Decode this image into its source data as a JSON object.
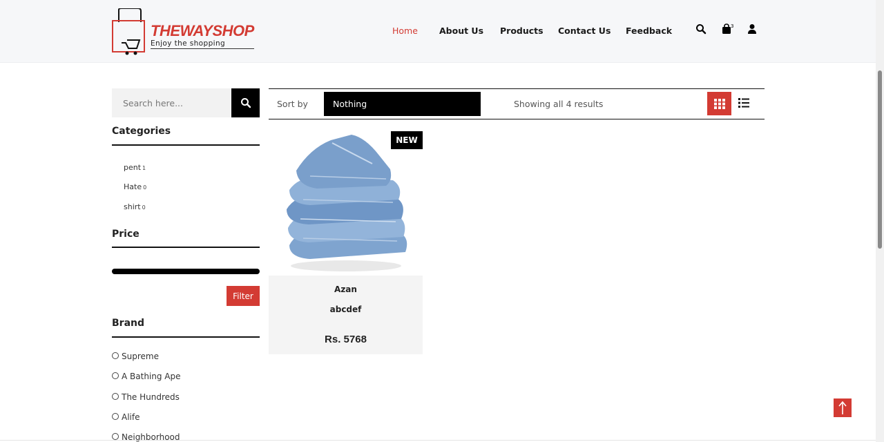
{
  "brand": {
    "title": "THEWAYSHOP",
    "tagline": "Enjoy the shopping",
    "accent_color": "#d33b33"
  },
  "nav": {
    "items": [
      {
        "label": "Home",
        "active": true
      },
      {
        "label": "About Us",
        "active": false
      },
      {
        "label": "Products",
        "active": false
      },
      {
        "label": "Contact Us",
        "active": false
      },
      {
        "label": "Feedback",
        "active": false
      }
    ],
    "icons": [
      "search-icon",
      "cart-icon",
      "user-icon"
    ],
    "cart_count": "3"
  },
  "sidebar": {
    "search_placeholder": "Search here...",
    "categories_title": "Categories",
    "categories": [
      {
        "name": "pent",
        "count": "1"
      },
      {
        "name": "Hate",
        "count": "0"
      },
      {
        "name": "shirt",
        "count": "0"
      }
    ],
    "price_title": "Price",
    "filter_label": "Filter",
    "brand_title": "Brand",
    "brands": [
      "Supreme",
      "A Bathing Ape",
      "The Hundreds",
      "Alife",
      "Neighborhood"
    ]
  },
  "toolbar": {
    "sort_label": "Sort by",
    "sort_value": "Nothing",
    "results_text": "Showing all 4 results"
  },
  "products": [
    {
      "badge": "NEW",
      "name": "Azan",
      "description": "abcdef",
      "price": "Rs. 5768"
    }
  ]
}
